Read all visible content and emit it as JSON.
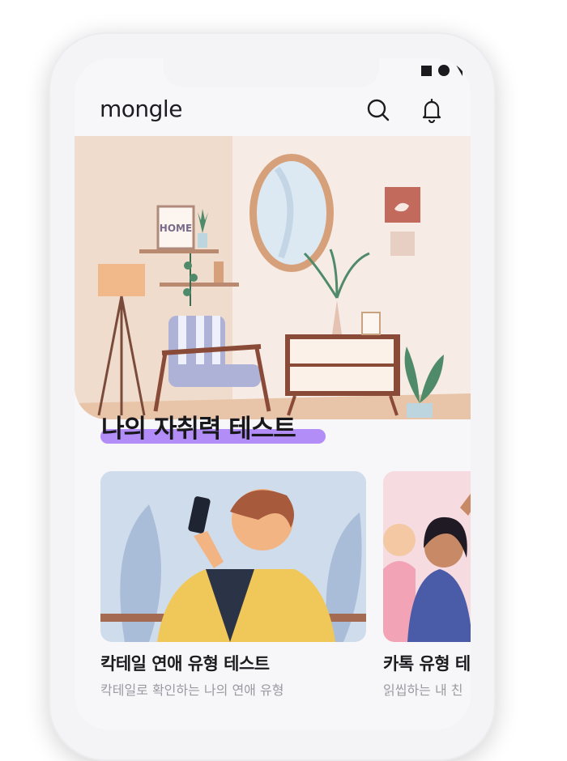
{
  "app": {
    "logo": "mongle"
  },
  "header": {
    "search_icon": "search-icon",
    "bell_icon": "bell-icon"
  },
  "hero": {
    "title": "나의 자취력 테스트",
    "frame_text": "HOME",
    "highlight_color": "#b28cf7"
  },
  "cards": [
    {
      "title": "칵테일 연애 유형 테스트",
      "subtitle": "칵테일로 확인하는 나의 연애 유형"
    },
    {
      "title": "카톡 유형 테",
      "subtitle": "읽씹하는 내 친"
    }
  ]
}
